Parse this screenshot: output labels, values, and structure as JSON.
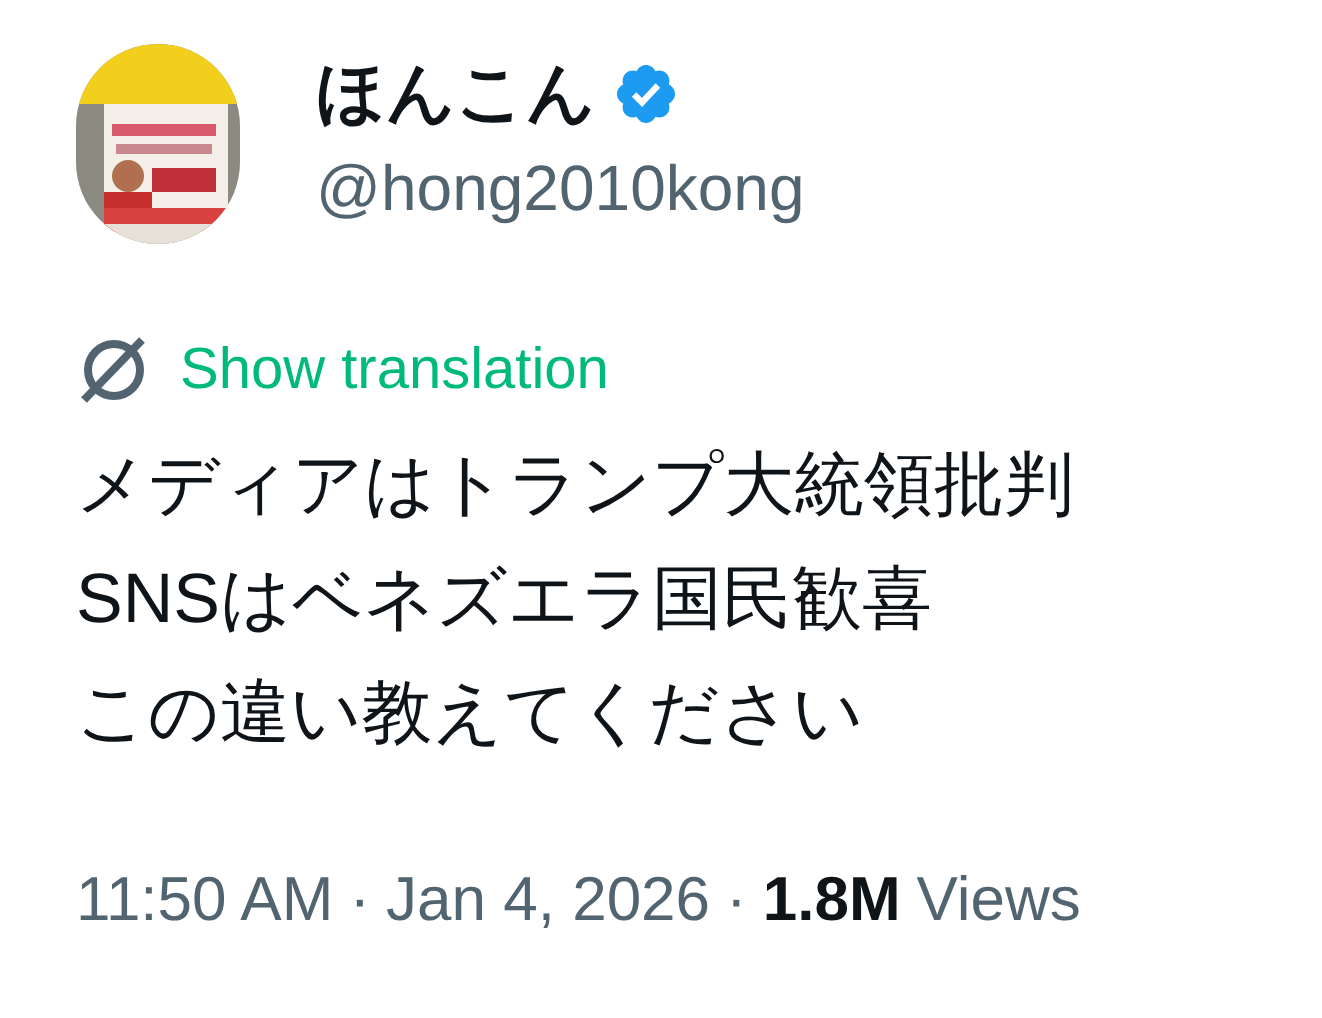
{
  "author": {
    "display_name": "ほんこん",
    "verified": true,
    "handle": "@hong2010kong"
  },
  "translation_link": "Show translation",
  "body_lines": [
    "メディアはトランプ大統領批判",
    "SNSはベネズエラ国民歓喜",
    "この違い教えてください"
  ],
  "meta": [
    {
      "kind": "time",
      "text": "11:50 AM"
    },
    {
      "kind": "separator",
      "text": "·"
    },
    {
      "kind": "date",
      "text": "Jan 4, 2026"
    },
    {
      "kind": "separator",
      "text": "·"
    },
    {
      "kind": "views_count",
      "text": "1.8M"
    },
    {
      "kind": "views_label",
      "text": "Views"
    }
  ]
}
